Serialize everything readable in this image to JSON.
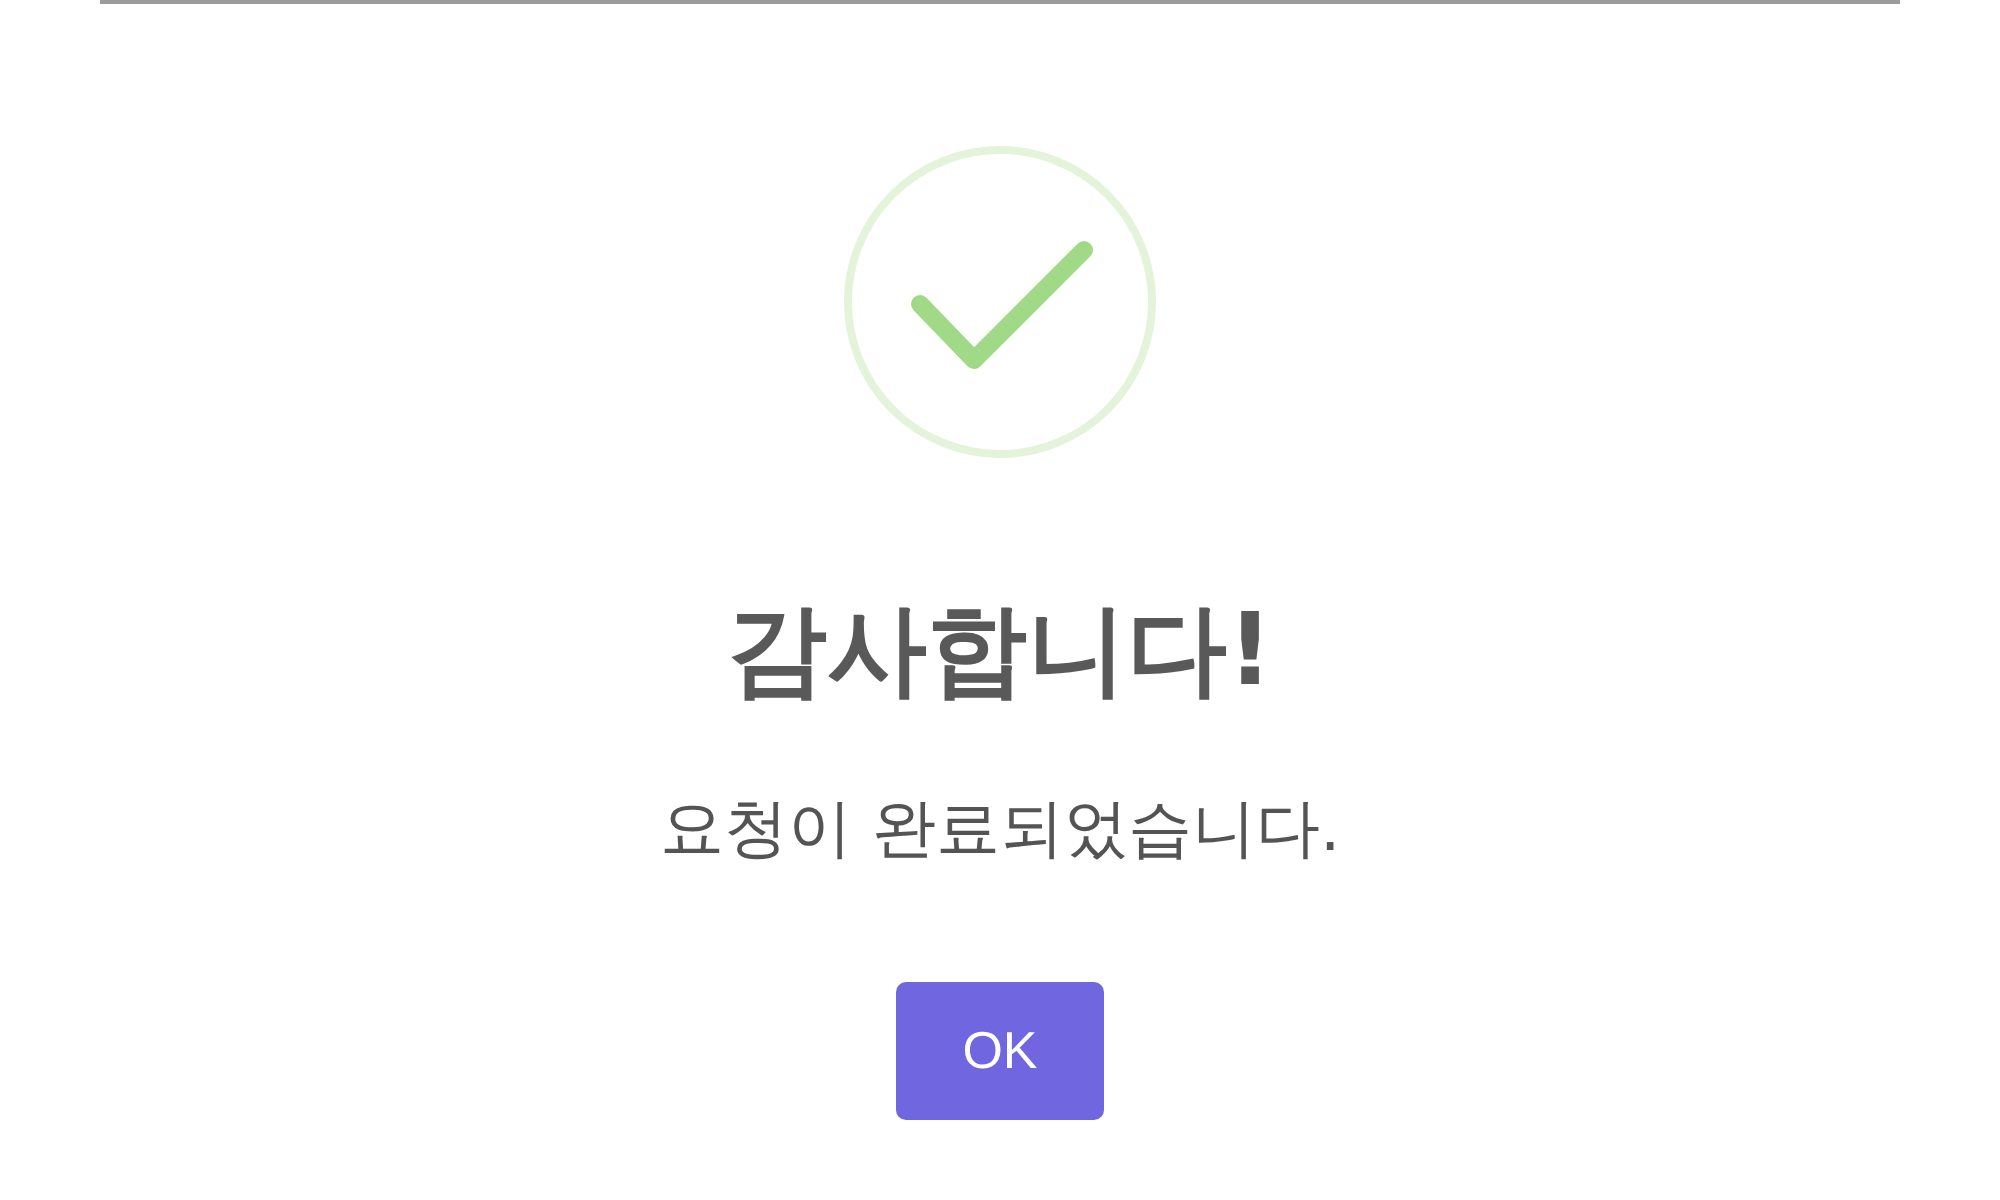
{
  "dialog": {
    "title": "감사합니다!",
    "message": "요청이 완료되었습니다.",
    "buttons": [
      {
        "label": "OK"
      }
    ]
  }
}
